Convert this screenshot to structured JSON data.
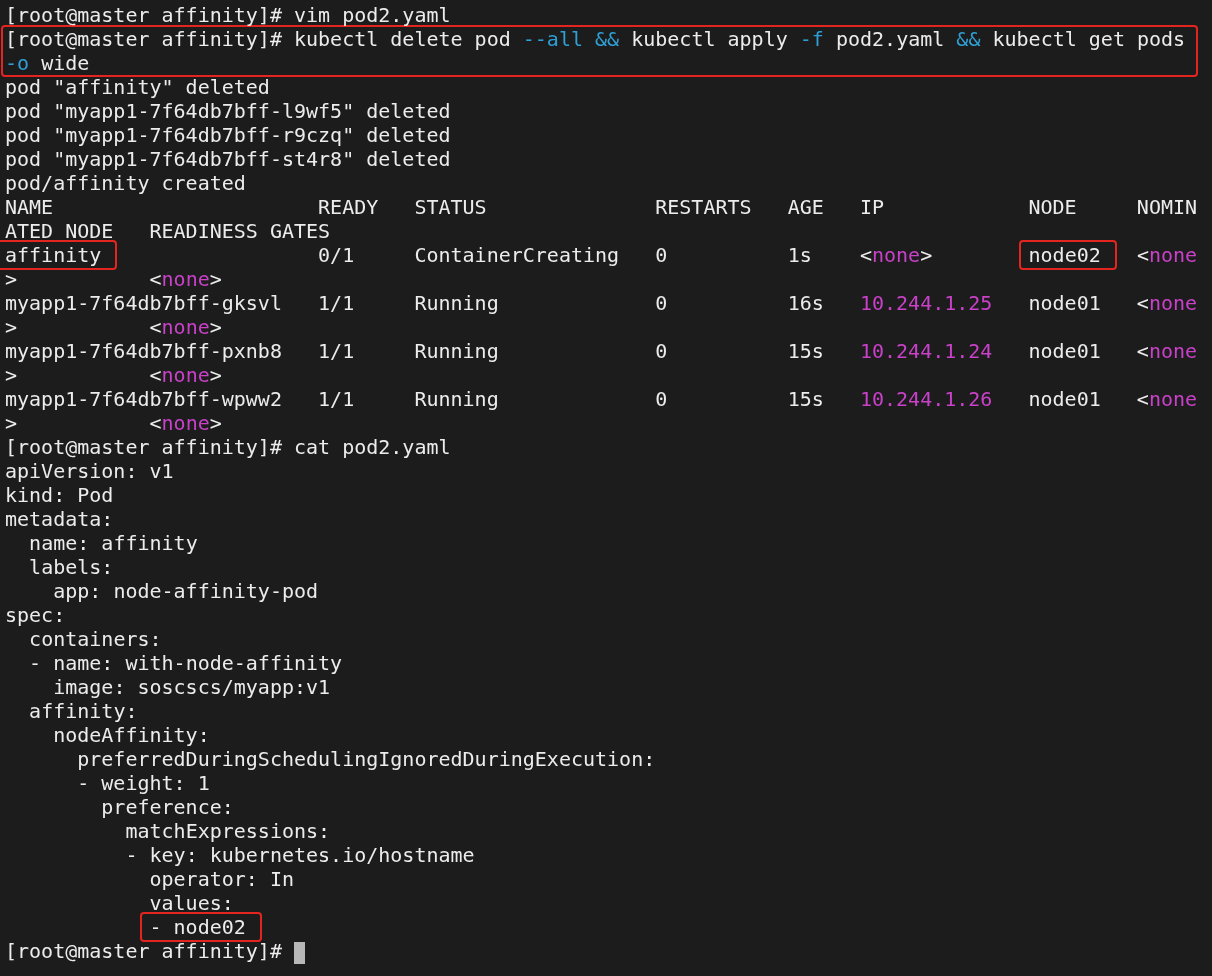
{
  "terminal": {
    "blocks": [
      {
        "boxed": false,
        "lines": [
          [
            {
              "text": "[root@master affinity]# vim pod2.yaml",
              "kind": "text"
            }
          ]
        ]
      },
      {
        "boxed": true,
        "lines": [
          [
            {
              "text": "[root@master affinity]# kubectl delete pod ",
              "kind": "text"
            },
            {
              "text": "--all",
              "kind": "option"
            },
            {
              "text": " &&",
              "kind": "option"
            },
            {
              "text": " kubectl apply ",
              "kind": "text"
            },
            {
              "text": "-f",
              "kind": "option"
            },
            {
              "text": " pod2.yaml ",
              "kind": "text"
            },
            {
              "text": "&&",
              "kind": "option"
            },
            {
              "text": " kubectl get pods",
              "kind": "text"
            }
          ],
          [
            {
              "text": "-o",
              "kind": "option"
            },
            {
              "text": " wide",
              "kind": "text"
            }
          ]
        ]
      },
      {
        "boxed": false,
        "lines": [
          [
            {
              "text": "pod \"affinity\" deleted",
              "kind": "text"
            }
          ],
          [
            {
              "text": "pod \"myapp1-7f64db7bff-l9wf5\" deleted",
              "kind": "text"
            }
          ],
          [
            {
              "text": "pod \"myapp1-7f64db7bff-r9czq\" deleted",
              "kind": "text"
            }
          ],
          [
            {
              "text": "pod \"myapp1-7f64db7bff-st4r8\" deleted",
              "kind": "text"
            }
          ],
          [
            {
              "text": "pod/affinity created",
              "kind": "text"
            }
          ],
          [
            {
              "text": "NAME                      READY   STATUS              RESTARTS   AGE   IP            NODE     NOMIN",
              "kind": "text"
            }
          ],
          [
            {
              "text": "ATED NODE   READINESS GATES",
              "kind": "text"
            }
          ],
          [
            {
              "text": "affinity",
              "kind": "boxed"
            },
            {
              "text": "                  0/1     ContainerCreating   0          1s    <",
              "kind": "text"
            },
            {
              "text": "none",
              "kind": "value"
            },
            {
              "text": ">        ",
              "kind": "text"
            },
            {
              "text": "node02",
              "kind": "boxed"
            },
            {
              "text": "   <",
              "kind": "text"
            },
            {
              "text": "none",
              "kind": "value"
            }
          ],
          [
            {
              "text": ">           <",
              "kind": "text"
            },
            {
              "text": "none",
              "kind": "value"
            },
            {
              "text": ">",
              "kind": "text"
            }
          ],
          [
            {
              "text": "myapp1-7f64db7bff-gksvl   1/1     Running             0          16s   ",
              "kind": "text"
            },
            {
              "text": "10.244.1.25",
              "kind": "value"
            },
            {
              "text": "   node01   <",
              "kind": "text"
            },
            {
              "text": "none",
              "kind": "value"
            }
          ],
          [
            {
              "text": ">           <",
              "kind": "text"
            },
            {
              "text": "none",
              "kind": "value"
            },
            {
              "text": ">",
              "kind": "text"
            }
          ],
          [
            {
              "text": "myapp1-7f64db7bff-pxnb8   1/1     Running             0          15s   ",
              "kind": "text"
            },
            {
              "text": "10.244.1.24",
              "kind": "value"
            },
            {
              "text": "   node01   <",
              "kind": "text"
            },
            {
              "text": "none",
              "kind": "value"
            }
          ],
          [
            {
              "text": ">           <",
              "kind": "text"
            },
            {
              "text": "none",
              "kind": "value"
            },
            {
              "text": ">",
              "kind": "text"
            }
          ],
          [
            {
              "text": "myapp1-7f64db7bff-wpww2   1/1     Running             0          15s   ",
              "kind": "text"
            },
            {
              "text": "10.244.1.26",
              "kind": "value"
            },
            {
              "text": "   node01   <",
              "kind": "text"
            },
            {
              "text": "none",
              "kind": "value"
            }
          ],
          [
            {
              "text": ">           <",
              "kind": "text"
            },
            {
              "text": "none",
              "kind": "value"
            },
            {
              "text": ">",
              "kind": "text"
            }
          ],
          [
            {
              "text": "[root@master affinity]# cat pod2.yaml",
              "kind": "text"
            }
          ],
          [
            {
              "text": "apiVersion: v1",
              "kind": "text"
            }
          ],
          [
            {
              "text": "kind: Pod",
              "kind": "text"
            }
          ],
          [
            {
              "text": "metadata:",
              "kind": "text"
            }
          ],
          [
            {
              "text": "  name: affinity",
              "kind": "text"
            }
          ],
          [
            {
              "text": "  labels:",
              "kind": "text"
            }
          ],
          [
            {
              "text": "    app: node-affinity-pod",
              "kind": "text"
            }
          ],
          [
            {
              "text": "spec:",
              "kind": "text"
            }
          ],
          [
            {
              "text": "  containers:",
              "kind": "text"
            }
          ],
          [
            {
              "text": "  - name: with-node-affinity",
              "kind": "text"
            }
          ],
          [
            {
              "text": "    image: soscscs/myapp:v1",
              "kind": "text"
            }
          ],
          [
            {
              "text": "  affinity:",
              "kind": "text"
            }
          ],
          [
            {
              "text": "    nodeAffinity:",
              "kind": "text"
            }
          ],
          [
            {
              "text": "      preferredDuringSchedulingIgnoredDuringExecution:",
              "kind": "text"
            }
          ],
          [
            {
              "text": "      - weight: 1",
              "kind": "text"
            }
          ],
          [
            {
              "text": "        preference:",
              "kind": "text"
            }
          ],
          [
            {
              "text": "          matchExpressions:",
              "kind": "text"
            }
          ],
          [
            {
              "text": "          - key: kubernetes.io/hostname",
              "kind": "text"
            }
          ],
          [
            {
              "text": "            operator: In",
              "kind": "text"
            }
          ],
          [
            {
              "text": "            values:",
              "kind": "text"
            }
          ],
          [
            {
              "text": "            - node02",
              "kind": "boxed"
            }
          ],
          [
            {
              "text": "[root@master affinity]# ",
              "kind": "text"
            }
          ]
        ]
      }
    ]
  }
}
